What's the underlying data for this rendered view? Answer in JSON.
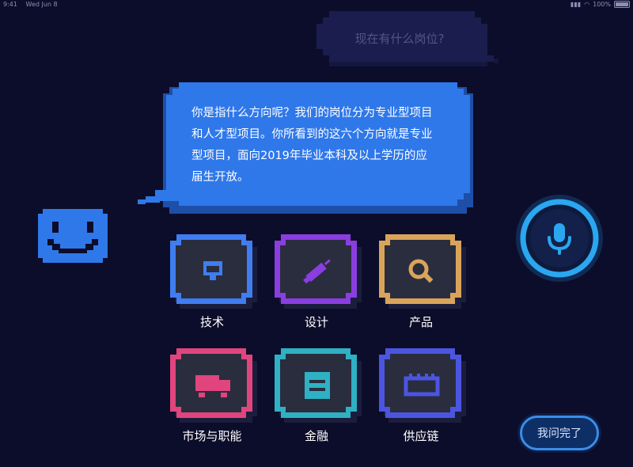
{
  "status_bar": {
    "time": "9:41",
    "date": "Wed Jun 8",
    "battery": "100%"
  },
  "chat": {
    "user_question": "现在有什么岗位?",
    "bot_answer": "你是指什么方向呢？我们的岗位分为专业型项目和人才型项目。你所看到的这六个方向就是专业型项目，面向2019年毕业本科及以上学历的应届生开放。"
  },
  "categories": [
    {
      "label": "技术",
      "color": "#3f7df0",
      "icon": "monitor-icon"
    },
    {
      "label": "设计",
      "color": "#8a3ee0",
      "icon": "pen-icon"
    },
    {
      "label": "产品",
      "color": "#d9a45a",
      "icon": "magnifier-icon"
    },
    {
      "label": "市场与职能",
      "color": "#e0457e",
      "icon": "truck-icon"
    },
    {
      "label": "金融",
      "color": "#2fb1c4",
      "icon": "wallet-icon"
    },
    {
      "label": "供应链",
      "color": "#4b55e0",
      "icon": "chip-icon"
    }
  ],
  "done_button": {
    "label": "我问完了"
  },
  "colors": {
    "background": "#0c0d2a",
    "bubble": "#2f78ea",
    "question_bubble": "#1a1d4d",
    "mic_ring": "#2aa7ef"
  }
}
